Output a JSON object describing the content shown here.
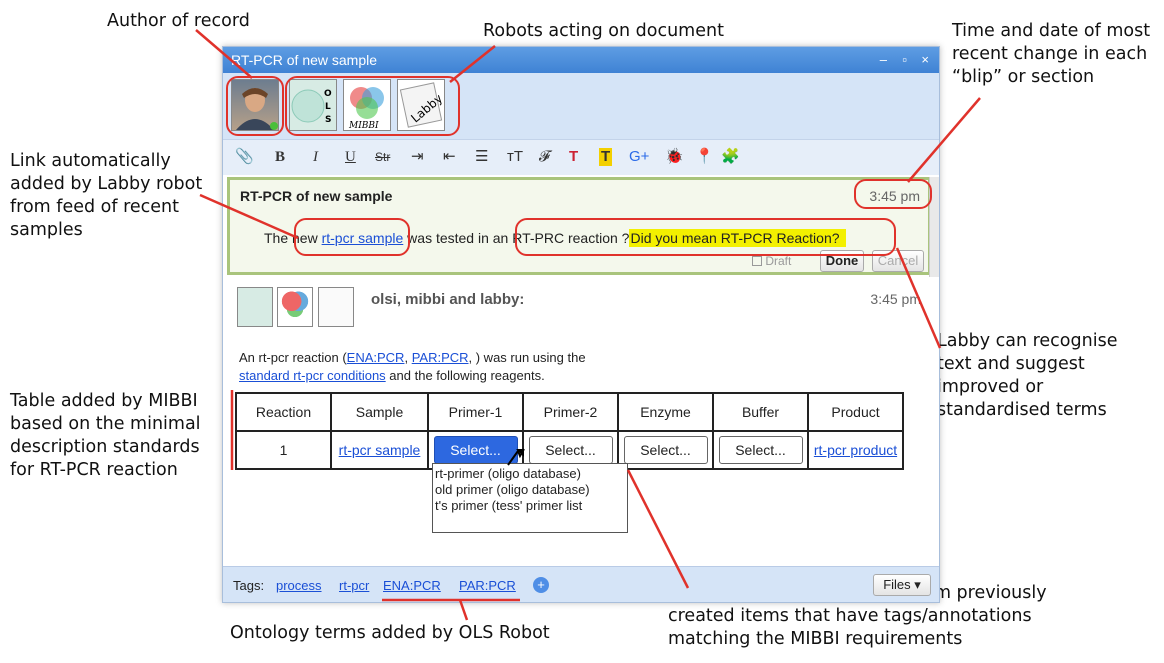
{
  "callouts": {
    "author": "Author of record",
    "robots": "Robots acting on document",
    "time": "Time and date of most\nrecent change in each\n“blip” or section",
    "link": "Link automatically\nadded by Labby robot\nfrom feed of recent\nsamples",
    "labby": "Labby can recognise\ntext and suggest\nimproved or\nstandardised terms",
    "table": "Table added by MIBBI\nbased on the minimal\ndescription standards\nfor RT-PCR reaction",
    "ontology": "Ontology terms added by OLS Robot",
    "menus": "Menus populated by Labby from previously\ncreated items that have tags/annotations\nmatching the MIBBI requirements"
  },
  "window": {
    "title": "RT-PCR of new sample",
    "controls": [
      "–",
      "▫",
      "×"
    ]
  },
  "participants": [
    {
      "name": "author-avatar",
      "label": ""
    },
    {
      "name": "ols-robot-avatar",
      "label": "O L S"
    },
    {
      "name": "mibbi-robot-avatar",
      "label": "MIBBI"
    },
    {
      "name": "labby-robot-avatar",
      "label": "Labby"
    }
  ],
  "toolbar": [
    "📎",
    "B",
    "I",
    "U",
    "Str",
    "⇥",
    "⇤",
    "☰",
    "тT",
    "𝓕",
    "T",
    "T",
    "G+",
    "🐞",
    "📍",
    "🧩"
  ],
  "editor": {
    "title": "RT-PCR of new sample",
    "time": "3:45 pm",
    "text_before": "The new ",
    "link": "rt-pcr sample",
    "text_middle": " was tested in an ",
    "typed": "RT-PRC reaction ?",
    "suggestion": "Did you mean RT-PCR Reaction?",
    "draft": "Draft",
    "done": "Done",
    "cancel": "Cancel"
  },
  "blip": {
    "authors": "olsi, mibbi and labby:",
    "time": "3:45 pm",
    "line1_before": "An rt-pcr reaction (",
    "link_ena": "ENA:PCR",
    "sep": ", ",
    "link_par": "PAR:PCR",
    "line1_after": ", ) was run using the",
    "link_conditions": "standard rt-pcr conditions",
    "line2_after": " and the following reagents."
  },
  "table": {
    "headers": [
      "Reaction",
      "Sample",
      "Primer-1",
      "Primer-2",
      "Enzyme",
      "Buffer",
      "Product"
    ],
    "row": {
      "reaction": "1",
      "sample": "rt-pcr sample",
      "primer1": "Select...",
      "primer2": "Select...",
      "enzyme": "Select...",
      "buffer": "Select...",
      "product": "rt-pcr product"
    }
  },
  "dropdown": [
    "rt-primer (oligo database)",
    "old primer (oligo database)",
    "t's primer (tess' primer list"
  ],
  "tags": {
    "label": "Tags:",
    "items": [
      "process",
      "rt-pcr",
      "ENA:PCR",
      "PAR:PCR"
    ],
    "files": "Files ▾"
  },
  "colors": {
    "accent": "#3f82d4",
    "annotation": "#e0322b",
    "suggestion": "#f3f000"
  }
}
